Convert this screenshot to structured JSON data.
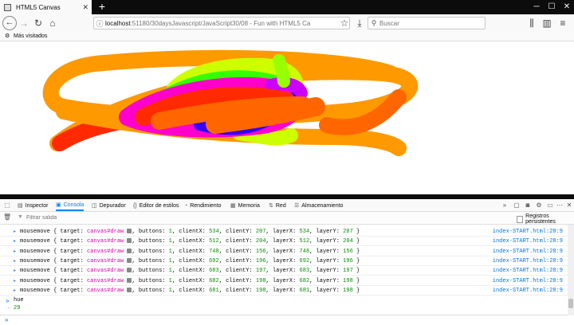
{
  "browser": {
    "tab_title": "HTML5 Canvas",
    "new_tab": "+",
    "url_host": "localhost",
    "url_rest": ":51180/30daysJavascript/JavaScript30/08 - Fun with HTML5 Ca",
    "search_placeholder": "Buscar",
    "bookmark_label": "Más visitados"
  },
  "devtools": {
    "tabs": [
      "Inspector",
      "Consola",
      "Depurador",
      "Editor de estilos",
      "Rendimiento",
      "Memoria",
      "Red",
      "Almacenamiento"
    ],
    "filter_placeholder": "Filtrar salida",
    "persist_label": "Registros persistentes"
  },
  "console": {
    "rows": [
      {
        "clientX": "534",
        "clientY": "207",
        "layerX": "534",
        "layerY": "207",
        "loc": "index-START.html:28:9"
      },
      {
        "clientX": "512",
        "clientY": "204",
        "layerX": "512",
        "layerY": "204",
        "loc": "index-START.html:28:9"
      },
      {
        "clientX": "748",
        "clientY": "156",
        "layerX": "748",
        "layerY": "156",
        "loc": "index-START.html:28:9"
      },
      {
        "clientX": "692",
        "clientY": "196",
        "layerX": "692",
        "layerY": "196",
        "loc": "index-START.html:28:9"
      },
      {
        "clientX": "683",
        "clientY": "197",
        "layerX": "683",
        "layerY": "197",
        "loc": "index-START.html:28:9"
      },
      {
        "clientX": "682",
        "clientY": "198",
        "layerX": "682",
        "layerY": "198",
        "loc": "index-START.html:28:9"
      },
      {
        "clientX": "681",
        "clientY": "198",
        "layerX": "681",
        "layerY": "198",
        "loc": "index-START.html:28:9"
      }
    ],
    "event_name": "mousemove",
    "target_label": "target:",
    "canvas_ref": "canvas#draw",
    "buttons_label": "buttons:",
    "buttons_value": "1",
    "input_text": "hue",
    "output_value": "29"
  },
  "icons": {
    "back": "back-arrow-icon",
    "forward": "forward-arrow-icon",
    "reload": "reload-icon",
    "home": "home-icon",
    "info": "info-icon",
    "bookmark_star": "star-icon",
    "download": "download-icon",
    "library": "library-icon",
    "sidebar": "sidebar-icon",
    "menu": "hamburger-menu-icon"
  },
  "colors": {
    "accent": "#0a84ff",
    "canvas_stroke_hues": [
      "#ff2a00",
      "#ff6600",
      "#ff9900",
      "#ccff00",
      "#33ff00",
      "#ff00cc",
      "#cc00ff",
      "#3300ff"
    ]
  }
}
